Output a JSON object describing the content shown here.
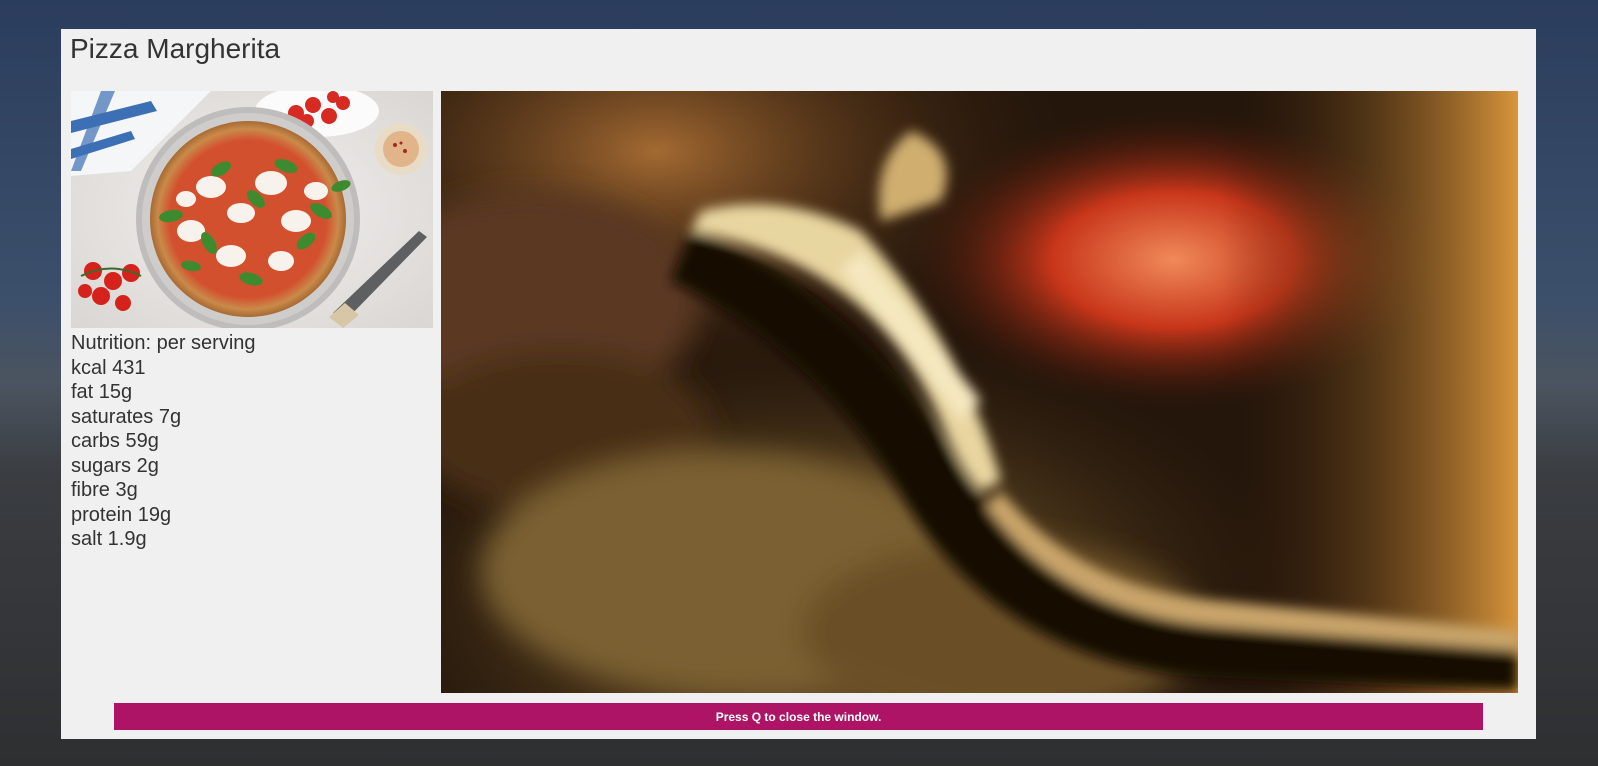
{
  "window": {
    "title": "Pizza Margherita"
  },
  "recipe_image": {
    "icon": "pizza-photo"
  },
  "nutrition": {
    "heading": "Nutrition: per serving",
    "items": [
      "kcal 431",
      "fat 15g",
      "saturates 7g",
      "carbs 59g",
      "sugars 2g",
      "fibre 3g",
      "protein 19g",
      "salt 1.9g"
    ]
  },
  "video": {
    "icon": "cooking-video-frame"
  },
  "status_bar": {
    "message": "Press Q to close the window.",
    "color": "#ad1466"
  }
}
